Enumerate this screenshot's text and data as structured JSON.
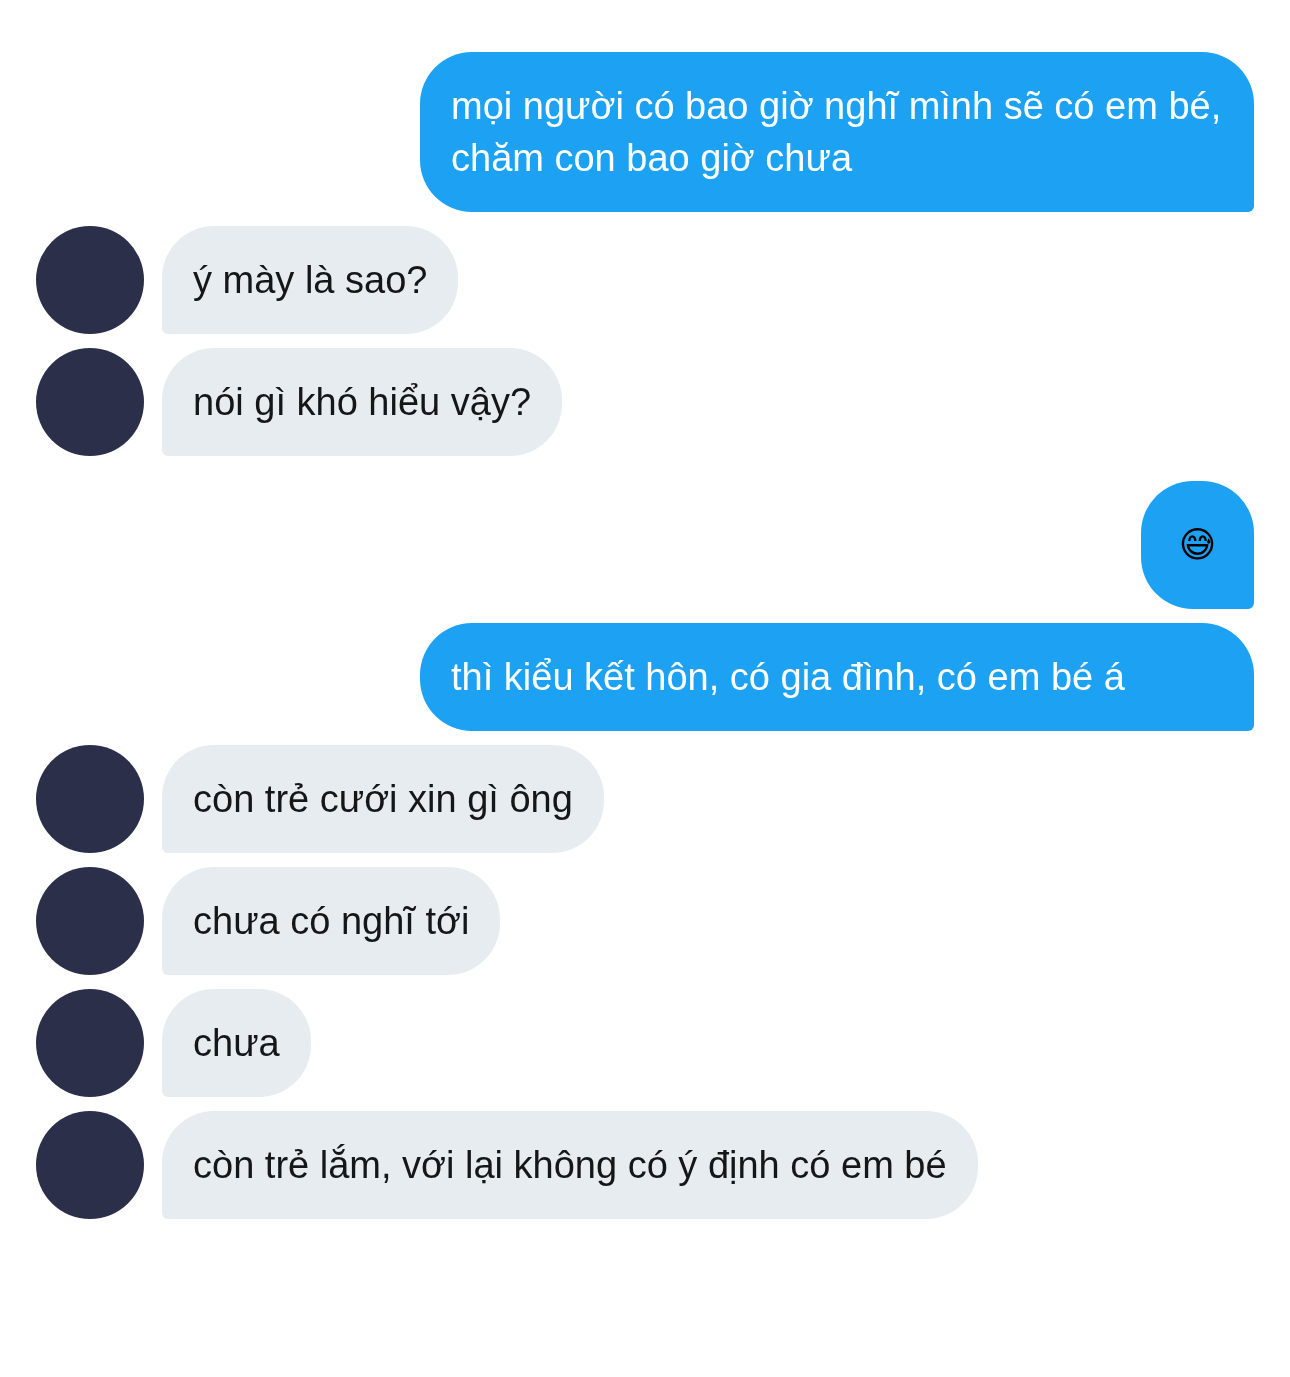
{
  "messages": [
    {
      "kind": "sent",
      "text": "mọi người có bao giờ nghĩ mình sẽ có em bé, chăm con bao giờ chưa"
    },
    {
      "kind": "received",
      "text": "ý mày là sao?"
    },
    {
      "kind": "received",
      "text": "nói gì khó hiểu vậy?"
    },
    {
      "kind": "emoji",
      "text": "😅"
    },
    {
      "kind": "sent",
      "text": "thì kiểu kết hôn, có gia đình, có em bé á"
    },
    {
      "kind": "received",
      "text": "còn trẻ cưới xin gì ông"
    },
    {
      "kind": "received",
      "text": "chưa có nghĩ tới"
    },
    {
      "kind": "received",
      "text": "chưa"
    },
    {
      "kind": "received",
      "text": "còn trẻ lắm, với lại không có ý định có em bé"
    }
  ]
}
